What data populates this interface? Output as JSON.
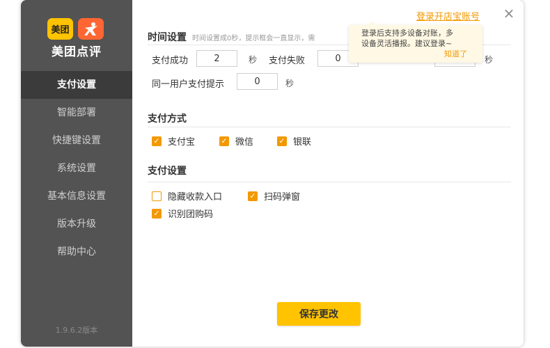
{
  "app": {
    "logo_meituan": "美团",
    "logo_text": "美团点评",
    "version": "1.9.6.2版本"
  },
  "sidebar": {
    "items": [
      {
        "label": "支付设置",
        "active": true
      },
      {
        "label": "智能部署",
        "active": false
      },
      {
        "label": "快捷键设置",
        "active": false
      },
      {
        "label": "系统设置",
        "active": false
      },
      {
        "label": "基本信息设置",
        "active": false
      },
      {
        "label": "版本升级",
        "active": false
      },
      {
        "label": "帮助中心",
        "active": false
      }
    ]
  },
  "header": {
    "login_link": "登录开店宝账号",
    "close_icon": "×"
  },
  "time_settings": {
    "title": "时间设置",
    "note": "时间设置成0秒，提示框会一直显示，需",
    "pay_success_label": "支付成功",
    "pay_success_value": "2",
    "pay_success_unit": "秒",
    "pay_fail_label": "支付失败",
    "pay_fail_value": "0",
    "pay_fail_unit": "秒",
    "same_user_label": "同一用户支付提示",
    "same_user_value": "0",
    "same_user_unit": "秒"
  },
  "tooltip": {
    "line1": "登录后支持多设备对账，多",
    "line2": "设备灵活播报。建议登录~",
    "ok": "知道了"
  },
  "payment_methods": {
    "title": "支付方式",
    "options": [
      {
        "label": "支付宝",
        "checked": true
      },
      {
        "label": "微信",
        "checked": true
      },
      {
        "label": "银联",
        "checked": true
      }
    ]
  },
  "payment_settings": {
    "title": "支付设置",
    "options": [
      {
        "label": "隐藏收款入口",
        "checked": false
      },
      {
        "label": "扫码弹窗",
        "checked": true
      },
      {
        "label": "识别团购码",
        "checked": true
      }
    ]
  },
  "footer": {
    "save_label": "保存更改"
  },
  "colors": {
    "accent": "#f39800",
    "brand_yellow": "#ffc300",
    "sidebar_bg": "#535353",
    "sidebar_active": "#3b3b3b"
  },
  "icons": {
    "logo_person": "dianping-person-icon",
    "close": "close-icon",
    "check": "checkmark-icon"
  }
}
